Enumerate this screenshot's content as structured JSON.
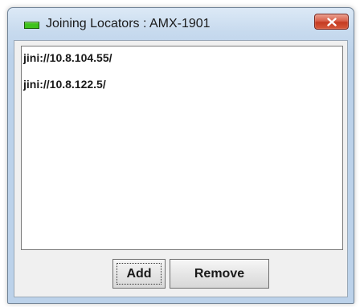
{
  "window": {
    "title": "Joining Locators : AMX-1901",
    "icon": "green-status-icon",
    "close_icon": "close-icon"
  },
  "locators": {
    "items": [
      {
        "label": "jini://10.8.104.55/"
      },
      {
        "label": "jini://10.8.122.5/"
      }
    ]
  },
  "buttons": {
    "add_label": "Add",
    "remove_label": "Remove"
  }
}
